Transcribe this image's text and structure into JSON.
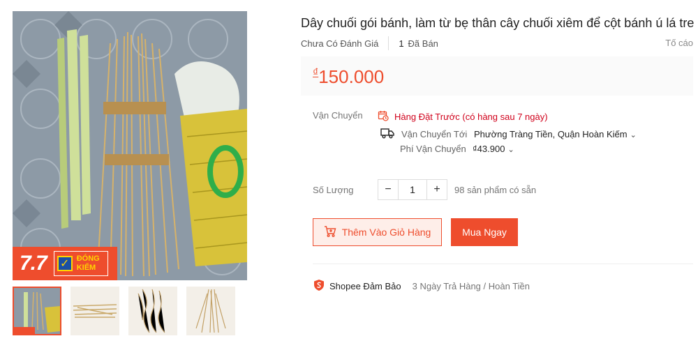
{
  "product": {
    "title": "Dây chuối gói bánh, làm từ bẹ thân cây chuối xiêm để cột bánh ú lá tre",
    "rating_text": "Chưa Có Đánh Giá",
    "sold_count": "1",
    "sold_label": "Đã Bán",
    "report_label": "Tố cáo",
    "price_currency": "₫",
    "price_value": "150.000"
  },
  "badge": {
    "number": "7.7",
    "line1": "ĐÓNG",
    "line2": "KIỂM",
    "check": "✓"
  },
  "shipping": {
    "label": "Vận Chuyển",
    "preorder_text": "Hàng Đặt Trước (có hàng sau 7 ngày)",
    "ship_to_label": "Vận Chuyển Tới",
    "ship_to_value": "Phường Tràng Tiền, Quận Hoàn Kiếm",
    "fee_label": "Phí Vận Chuyển",
    "fee_value": "₫43.900"
  },
  "quantity": {
    "label": "Số Lượng",
    "minus": "−",
    "value": "1",
    "plus": "+",
    "stock_text": "98 sản phẩm có sẵn"
  },
  "actions": {
    "add_to_cart": "Thêm Vào Giỏ Hàng",
    "buy_now": "Mua Ngay"
  },
  "guarantee": {
    "name": "Shopee Đảm Bảo",
    "description": "3 Ngày Trả Hàng / Hoàn Tiền"
  },
  "icons": {
    "preorder": "calendar-clock-icon",
    "truck": "truck-icon",
    "cart": "cart-plus-icon",
    "shield": "shield-icon",
    "chevron": "chevron-down-icon"
  },
  "colors": {
    "accent": "#ee4d2d",
    "preorder": "#d0011b",
    "badge_check_bg": "#1a4fa3",
    "badge_text": "#ffd400"
  }
}
